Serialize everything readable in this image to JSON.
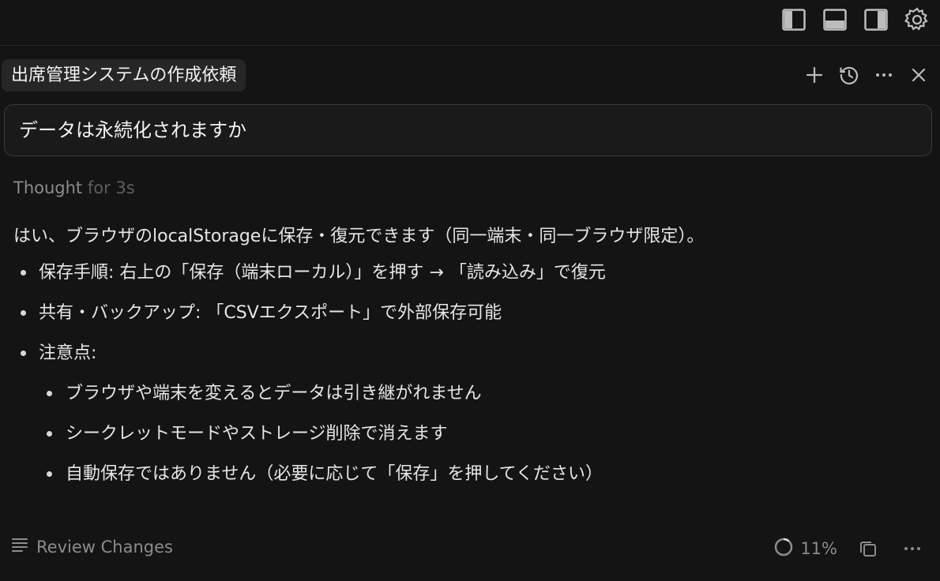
{
  "header": {
    "chat_title": "出席管理システムの作成依頼"
  },
  "prompt": {
    "text": "データは永続化されますか"
  },
  "thought": {
    "label": "Thought",
    "duration": "for 3s"
  },
  "answer": {
    "lead": "はい、ブラウザのlocalStorageに保存・復元できます（同一端末・同一ブラウザ限定）。",
    "items": [
      "保存手順: 右上の「保存（端末ローカル）」を押す → 「読み込み」で復元",
      "共有・バックアップ: 「CSVエクスポート」で外部保存可能",
      "注意点:"
    ],
    "subitems": [
      "ブラウザや端末を変えるとデータは引き継がれません",
      "シークレットモードやストレージ削除で消えます",
      "自動保存ではありません（必要に応じて「保存」を押してください）"
    ]
  },
  "footer": {
    "review_label": "Review Changes",
    "progress": "11%"
  },
  "icons": {
    "toggle_left": "sidebar-left-icon",
    "toggle_bottom": "panel-bottom-icon",
    "toggle_right": "sidebar-right-icon",
    "settings": "gear-icon",
    "new_chat": "plus-icon",
    "history": "history-icon",
    "more": "more-icon",
    "close": "close-icon",
    "review": "list-icon",
    "copy": "copy-icon"
  }
}
